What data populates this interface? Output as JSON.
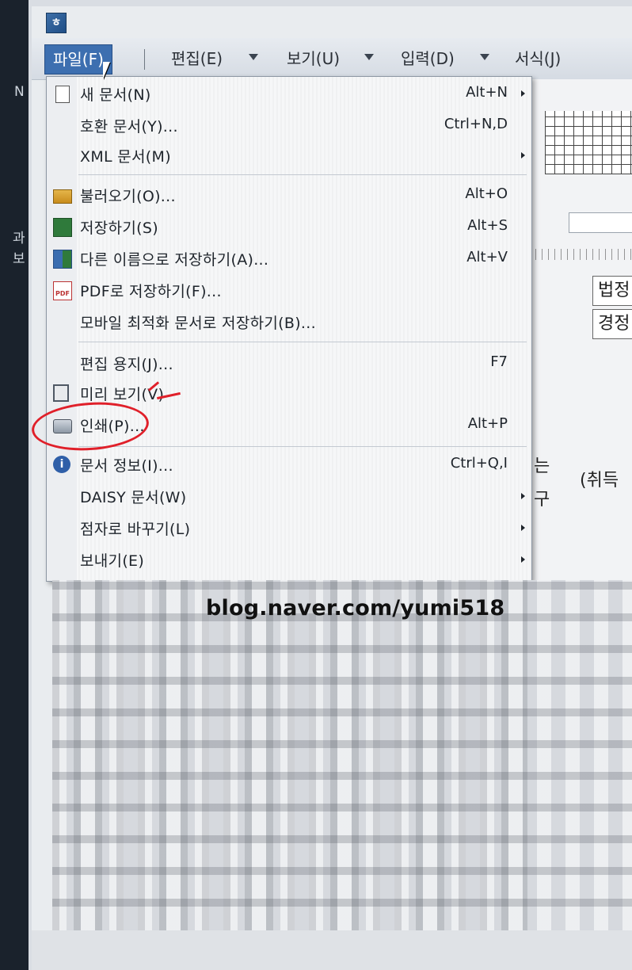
{
  "side_fragments": [
    "N",
    "과",
    "보"
  ],
  "app_icon": "app-logo-icon",
  "menubar": {
    "items": [
      {
        "label": "파일(F)",
        "active": true
      },
      {
        "label": "편집(E)"
      },
      {
        "label": "보기(U)"
      },
      {
        "label": "입력(D)"
      },
      {
        "label": "서식(J)"
      }
    ]
  },
  "background_doc": {
    "cells": [
      "법정",
      "경정"
    ],
    "fragments": [
      "는",
      "구",
      "(취득"
    ]
  },
  "file_menu": {
    "items": [
      {
        "label": "새 문서(N)",
        "shortcut": "Alt+N",
        "submenu": true,
        "icon": "new-document-icon"
      },
      {
        "label": "호환 문서(Y)...",
        "shortcut": "Ctrl+N,D",
        "submenu": false,
        "icon": ""
      },
      {
        "label": "XML 문서(M)",
        "shortcut": "",
        "submenu": true,
        "icon": ""
      },
      {
        "label": "불러오기(O)...",
        "shortcut": "Alt+O",
        "submenu": false,
        "icon": "folder-open-icon"
      },
      {
        "label": "저장하기(S)",
        "shortcut": "Alt+S",
        "submenu": false,
        "icon": "save-icon"
      },
      {
        "label": "다른 이름으로 저장하기(A)...",
        "shortcut": "Alt+V",
        "submenu": false,
        "icon": "save-as-icon"
      },
      {
        "label": "PDF로 저장하기(F)...",
        "shortcut": "",
        "submenu": false,
        "icon": "pdf-icon"
      },
      {
        "label": "모바일 최적화 문서로 저장하기(B)...",
        "shortcut": "",
        "submenu": false,
        "icon": ""
      },
      {
        "label": "편집 용지(J)...",
        "shortcut": "F7",
        "submenu": false,
        "icon": ""
      },
      {
        "label": "미리 보기(V)",
        "shortcut": "",
        "submenu": false,
        "icon": "print-preview-icon"
      },
      {
        "label": "인쇄(P)...",
        "shortcut": "Alt+P",
        "submenu": false,
        "icon": "printer-icon",
        "highlighted": true
      },
      {
        "label": "문서 정보(I)...",
        "shortcut": "Ctrl+Q,I",
        "submenu": false,
        "icon": "info-icon"
      },
      {
        "label": "DAISY 문서(W)",
        "shortcut": "",
        "submenu": true,
        "icon": ""
      },
      {
        "label": "점자로 바꾸기(L)",
        "shortcut": "",
        "submenu": true,
        "icon": ""
      },
      {
        "label": "보내기(E)",
        "shortcut": "",
        "submenu": true,
        "icon": ""
      }
    ]
  },
  "watermark": "blog.naver.com/yumi518",
  "annotation_color": "#e0202a",
  "accent_color": "#3d6fb0"
}
